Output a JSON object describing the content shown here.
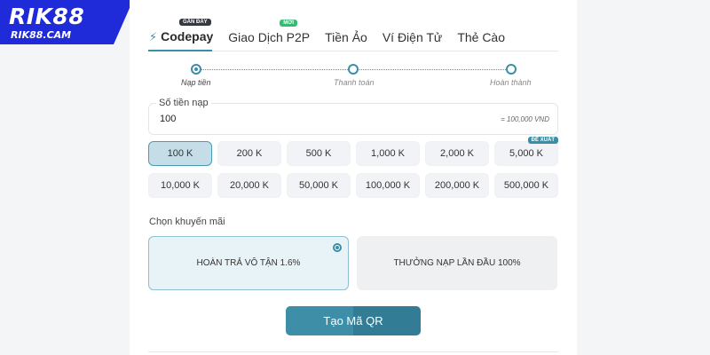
{
  "logo": {
    "text": "RIK88",
    "sub": "RIK88.CAM",
    "color": "#1f2ad8"
  },
  "tabs": [
    {
      "label": "Codepay",
      "badge": "GẦN ĐÂY",
      "active": true
    },
    {
      "label": "Giao Dịch P2P",
      "badge": "MỚI"
    },
    {
      "label": "Tiền Ảo"
    },
    {
      "label": "Ví Điện Tử"
    },
    {
      "label": "Thẻ Cào"
    }
  ],
  "steps": [
    "Nạp tiền",
    "Thanh toán",
    "Hoàn thành"
  ],
  "amount": {
    "label": "Số tiền nạp",
    "value": "100",
    "converted": "= 100,000 VND"
  },
  "chips": [
    "100 K",
    "200 K",
    "500 K",
    "1,000 K",
    "2,000 K",
    "5,000 K",
    "10,000 K",
    "20,000 K",
    "50,000 K",
    "100,000 K",
    "200,000 K",
    "500,000 K"
  ],
  "chip_badge": "ĐỀ XUẤT",
  "promo": {
    "title": "Chọn khuyến mãi",
    "options": [
      "HOÀN TRẢ VÔ TẬN 1.6%",
      "THƯỞNG NẠP LẦN ĐẦU 100%"
    ]
  },
  "submit_label": "Tạo Mã QR",
  "colors": {
    "accent": "#3b8ea8",
    "selected_bg": "#c4dde7",
    "new_badge": "#2fbf71"
  }
}
